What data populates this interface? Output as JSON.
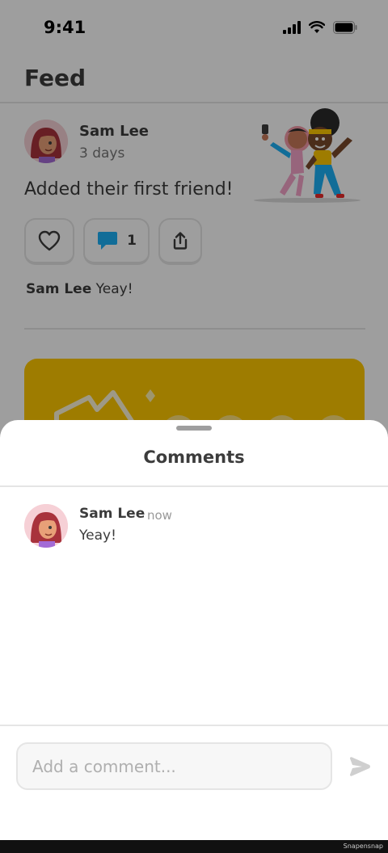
{
  "status_bar": {
    "time": "9:41"
  },
  "header": {
    "title": "Feed"
  },
  "post": {
    "author": "Sam Lee",
    "time": "3 days",
    "text": "Added their first friend!",
    "comment_count": "1",
    "preview_author": "Sam Lee",
    "preview_text": "Yeay!"
  },
  "sheet": {
    "title": "Comments",
    "comments": [
      {
        "author": "Sam Lee",
        "time": "now",
        "text": "Yeay!"
      }
    ],
    "input_placeholder": "Add a comment..."
  },
  "colors": {
    "accent_yellow": "#ffc800",
    "comment_blue": "#1cb0f6",
    "avatar_bg": "#f6d0d6",
    "border_gray": "#e5e5e5"
  },
  "icons": [
    "signal-icon",
    "wifi-icon",
    "battery-icon",
    "heart-icon",
    "comment-bubble-icon",
    "share-icon",
    "send-icon"
  ],
  "watermark": "Snapensnap"
}
